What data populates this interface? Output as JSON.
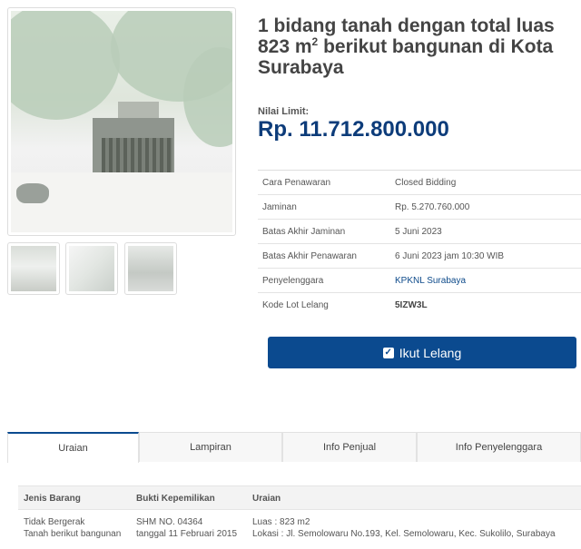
{
  "title": {
    "prefix": "1 bidang tanah dengan total luas 823 m",
    "superscript": "2",
    "suffix": " berikut bangunan di Kota Surabaya"
  },
  "nilai_limit": {
    "label": "Nilai Limit:",
    "value": "Rp. 11.712.800.000"
  },
  "info_rows": [
    {
      "label": "Cara Penawaran",
      "value": "Closed Bidding"
    },
    {
      "label": "Jaminan",
      "value": "Rp. 5.270.760.000"
    },
    {
      "label": "Batas Akhir Jaminan",
      "value": "5 Juni 2023"
    },
    {
      "label": "Batas Akhir Penawaran",
      "value": "6 Juni 2023 jam 10:30 WIB"
    },
    {
      "label": "Penyelenggara",
      "value": "KPKNL Surabaya"
    },
    {
      "label": "Kode Lot Lelang",
      "value": "5IZW3L"
    }
  ],
  "button": {
    "label": "Ikut Lelang",
    "icon": "check-square-icon",
    "color": "#0b4a8f"
  },
  "tabs": [
    {
      "label": "Uraian",
      "active": true
    },
    {
      "label": "Lampiran",
      "active": false
    },
    {
      "label": "Info Penjual",
      "active": false
    },
    {
      "label": "Info Penyelenggara",
      "active": false
    }
  ],
  "details": {
    "headers": [
      "Jenis Barang",
      "Bukti Kepemilikan",
      "Uraian"
    ],
    "row": {
      "jenis_1": "Tidak Bergerak",
      "jenis_2": "Tanah berikut bangunan",
      "bukti_1": "SHM NO. 04364",
      "bukti_2": "tanggal 11 Februari 2015",
      "uraian_1": "Luas : 823 m2",
      "uraian_2": "Lokasi : Jl. Semolowaru No.193, Kel. Semolowaru, Kec. Sukolilo, Surabaya"
    }
  },
  "colors": {
    "accent": "#0b4a8f",
    "price": "#0d3c7a",
    "link": "#0d4a8a"
  }
}
